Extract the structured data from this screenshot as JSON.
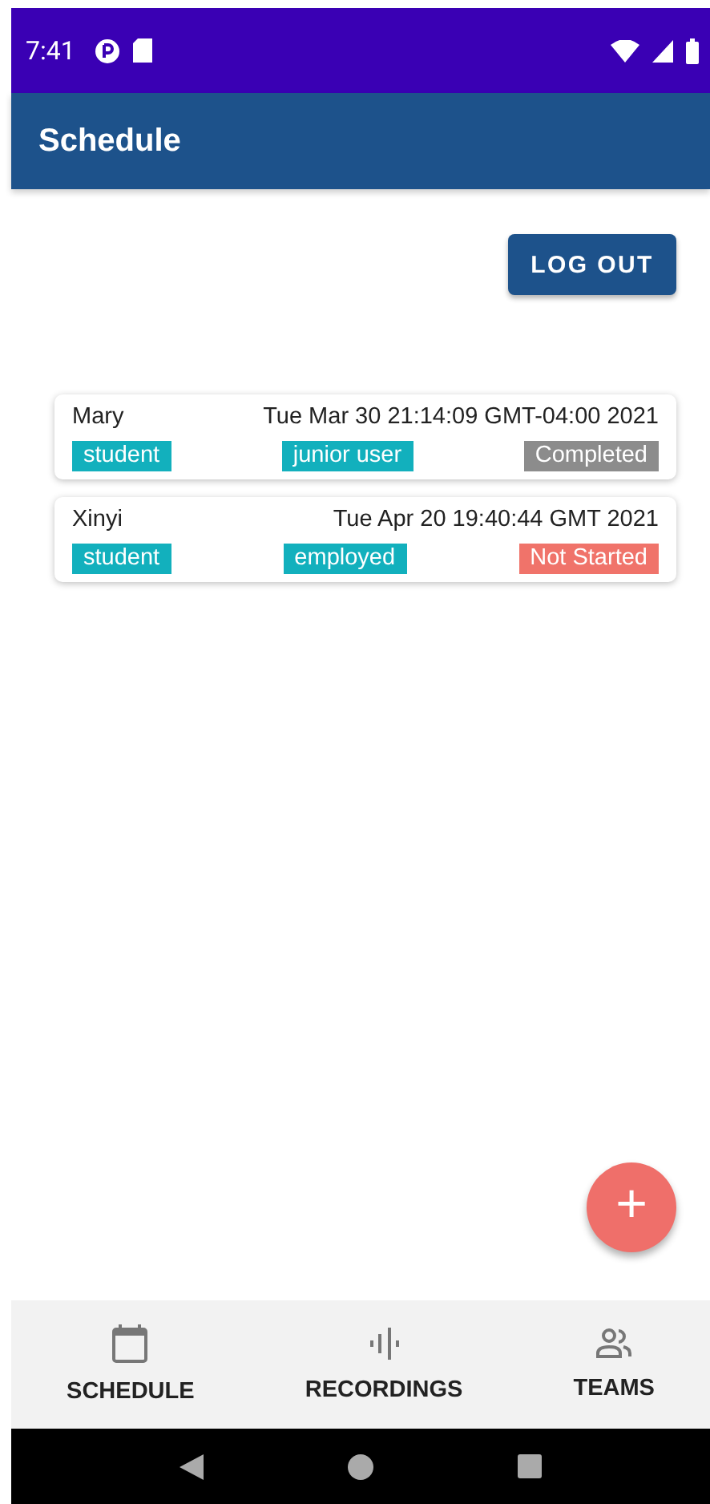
{
  "status_bar": {
    "time": "7:41"
  },
  "app_bar": {
    "title": "Schedule"
  },
  "logout_button": "LOG OUT",
  "sessions": [
    {
      "name": "Mary",
      "date": "Tue Mar 30 21:14:09 GMT-04:00 2021",
      "role": "student",
      "level": "junior user",
      "status": "Completed",
      "color": "#8c8c8c"
    },
    {
      "name": "Xinyi",
      "date": "Tue Apr 20 19:40:44 GMT 2021",
      "role": "student",
      "level": "employed",
      "status": "Not Started",
      "color": "#f0736a"
    }
  ],
  "fab": "+",
  "bottom_nav": [
    {
      "label": "SCHEDULE",
      "kind": "calendar"
    },
    {
      "label": "RECORDINGS",
      "kind": "audio"
    },
    {
      "label": "TEAMS",
      "kind": "people"
    }
  ]
}
